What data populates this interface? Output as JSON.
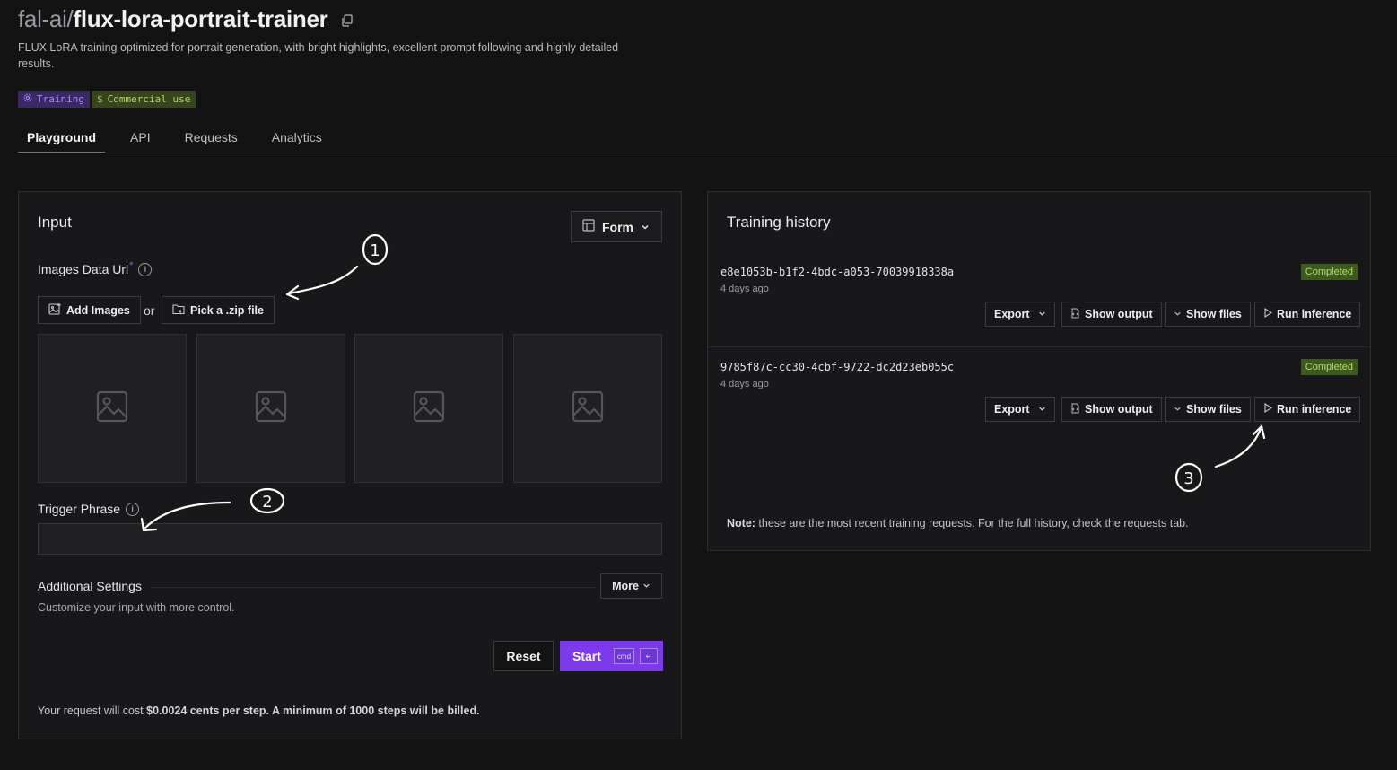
{
  "header": {
    "org": "fal-ai/",
    "name": "flux-lora-portrait-trainer",
    "description": "FLUX LoRA training optimized for portrait generation, with bright highlights, excellent prompt following and highly detailed results.",
    "badges": [
      {
        "label": "Training",
        "icon": "gear-icon",
        "color": "#a68cf5"
      },
      {
        "label": "Commercial use",
        "icon": "dollar-icon",
        "color": "#b6d36c"
      }
    ]
  },
  "tabs": [
    {
      "label": "Playground",
      "active": true
    },
    {
      "label": "API",
      "active": false
    },
    {
      "label": "Requests",
      "active": false
    },
    {
      "label": "Analytics",
      "active": false
    }
  ],
  "input": {
    "title": "Input",
    "view_mode": "Form",
    "images_label": "Images Data Url",
    "required_mark": "*",
    "add_images": "Add Images",
    "or_text": "or",
    "pick_zip": "Pick a .zip file",
    "trigger_label": "Trigger Phrase",
    "trigger_value": "",
    "settings_label": "Additional Settings",
    "more_label": "More",
    "settings_desc": "Customize your input with more control.",
    "reset_label": "Reset",
    "start_label": "Start",
    "shortcut_keys": [
      "cmd",
      "↵"
    ],
    "cost_prefix": "Your request will cost ",
    "cost_bold": "$0.0024 cents per step. A minimum of 1000 steps will be billed."
  },
  "history": {
    "title": "Training history",
    "items": [
      {
        "id": "e8e1053b-b1f2-4bdc-a053-70039918338a",
        "time": "4 days ago",
        "status": "Completed"
      },
      {
        "id": "9785f87c-cc30-4cbf-9722-dc2d23eb055c",
        "time": "4 days ago",
        "status": "Completed"
      }
    ],
    "actions": {
      "export": "Export",
      "show_output": "Show output",
      "show_files": "Show files",
      "run_inference": "Run inference"
    },
    "note_bold": "Note:",
    "note_text": " these are the most recent training requests. For the full history, check the requests tab."
  },
  "colors": {
    "accent": "#7c3aed",
    "completed_bg": "#3c5a1e",
    "completed_text": "#b9dc6e"
  },
  "annotations": [
    "1",
    "2",
    "3"
  ]
}
